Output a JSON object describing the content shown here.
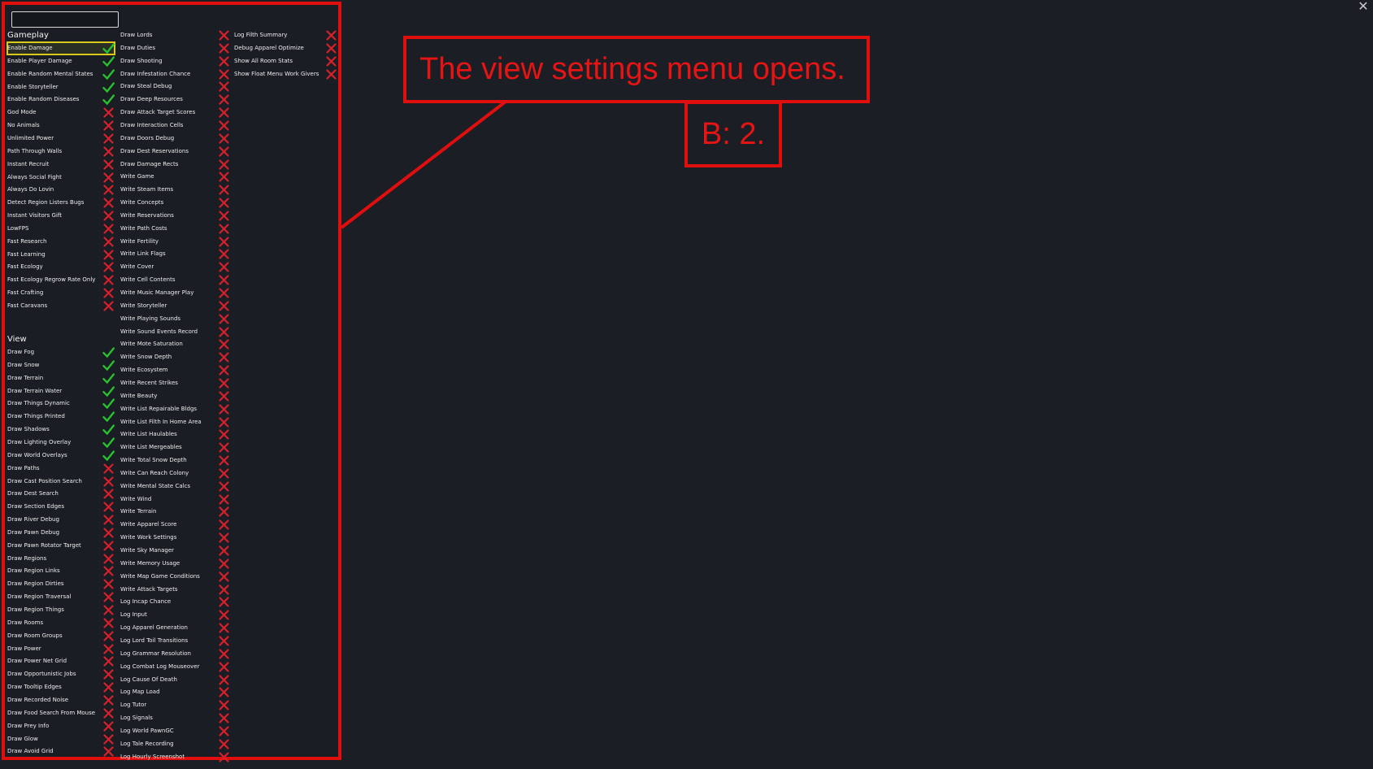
{
  "gameplay": {
    "title": "Gameplay",
    "items": [
      {
        "label": "Enable Damage",
        "on": true,
        "selected": true
      },
      {
        "label": "Enable Player Damage",
        "on": true
      },
      {
        "label": "Enable Random Mental States",
        "on": true
      },
      {
        "label": "Enable Storyteller",
        "on": true
      },
      {
        "label": "Enable Random Diseases",
        "on": true
      },
      {
        "label": "God Mode",
        "on": false
      },
      {
        "label": "No Animals",
        "on": false
      },
      {
        "label": "Unlimited Power",
        "on": false
      },
      {
        "label": "Path Through Walls",
        "on": false
      },
      {
        "label": "Instant Recruit",
        "on": false
      },
      {
        "label": "Always Social Fight",
        "on": false
      },
      {
        "label": "Always Do Lovin",
        "on": false
      },
      {
        "label": "Detect Region Listers Bugs",
        "on": false
      },
      {
        "label": "Instant Visitors Gift",
        "on": false
      },
      {
        "label": "LowFPS",
        "on": false
      },
      {
        "label": "Fast Research",
        "on": false
      },
      {
        "label": "Fast Learning",
        "on": false
      },
      {
        "label": "Fast Ecology",
        "on": false
      },
      {
        "label": "Fast Ecology Regrow Rate Only",
        "on": false
      },
      {
        "label": "Fast Crafting",
        "on": false
      },
      {
        "label": "Fast Caravans",
        "on": false
      }
    ]
  },
  "view": {
    "title": "View",
    "items": [
      {
        "label": "Draw Fog",
        "on": true
      },
      {
        "label": "Draw Snow",
        "on": true
      },
      {
        "label": "Draw Terrain",
        "on": true
      },
      {
        "label": "Draw Terrain Water",
        "on": true
      },
      {
        "label": "Draw Things Dynamic",
        "on": true
      },
      {
        "label": "Draw Things Printed",
        "on": true
      },
      {
        "label": "Draw Shadows",
        "on": true
      },
      {
        "label": "Draw Lighting Overlay",
        "on": true
      },
      {
        "label": "Draw World Overlays",
        "on": true
      },
      {
        "label": "Draw Paths",
        "on": false
      },
      {
        "label": "Draw Cast Position Search",
        "on": false
      },
      {
        "label": "Draw Dest Search",
        "on": false
      },
      {
        "label": "Draw Section Edges",
        "on": false
      },
      {
        "label": "Draw River Debug",
        "on": false
      },
      {
        "label": "Draw Pawn Debug",
        "on": false
      },
      {
        "label": "Draw Pawn Rotator Target",
        "on": false
      },
      {
        "label": "Draw Regions",
        "on": false
      },
      {
        "label": "Draw Region Links",
        "on": false
      },
      {
        "label": "Draw Region Dirties",
        "on": false
      },
      {
        "label": "Draw Region Traversal",
        "on": false
      },
      {
        "label": "Draw Region Things",
        "on": false
      },
      {
        "label": "Draw Rooms",
        "on": false
      },
      {
        "label": "Draw Room Groups",
        "on": false
      },
      {
        "label": "Draw Power",
        "on": false
      },
      {
        "label": "Draw Power Net Grid",
        "on": false
      },
      {
        "label": "Draw Opportunistic Jobs",
        "on": false
      },
      {
        "label": "Draw Tooltip Edges",
        "on": false
      },
      {
        "label": "Draw Recorded Noise",
        "on": false
      },
      {
        "label": "Draw Food Search From Mouse",
        "on": false
      },
      {
        "label": "Draw Prey Info",
        "on": false
      },
      {
        "label": "Draw Glow",
        "on": false
      },
      {
        "label": "Draw Avoid Grid",
        "on": false
      }
    ]
  },
  "column2": {
    "items": [
      {
        "label": "Draw Lords",
        "on": false
      },
      {
        "label": "Draw Duties",
        "on": false
      },
      {
        "label": "Draw Shooting",
        "on": false
      },
      {
        "label": "Draw Infestation Chance",
        "on": false
      },
      {
        "label": "Draw Steal Debug",
        "on": false
      },
      {
        "label": "Draw Deep Resources",
        "on": false
      },
      {
        "label": "Draw Attack Target Scores",
        "on": false
      },
      {
        "label": "Draw Interaction Cells",
        "on": false
      },
      {
        "label": "Draw Doors Debug",
        "on": false
      },
      {
        "label": "Draw Dest Reservations",
        "on": false
      },
      {
        "label": "Draw Damage Rects",
        "on": false
      },
      {
        "label": "Write Game",
        "on": false
      },
      {
        "label": "Write Steam Items",
        "on": false
      },
      {
        "label": "Write Concepts",
        "on": false
      },
      {
        "label": "Write Reservations",
        "on": false
      },
      {
        "label": "Write Path Costs",
        "on": false
      },
      {
        "label": "Write Fertility",
        "on": false
      },
      {
        "label": "Write Link Flags",
        "on": false
      },
      {
        "label": "Write Cover",
        "on": false
      },
      {
        "label": "Write Cell Contents",
        "on": false
      },
      {
        "label": "Write Music Manager Play",
        "on": false
      },
      {
        "label": "Write Storyteller",
        "on": false
      },
      {
        "label": "Write Playing Sounds",
        "on": false
      },
      {
        "label": "Write Sound Events Record",
        "on": false
      },
      {
        "label": "Write Mote Saturation",
        "on": false
      },
      {
        "label": "Write Snow Depth",
        "on": false
      },
      {
        "label": "Write Ecosystem",
        "on": false
      },
      {
        "label": "Write Recent Strikes",
        "on": false
      },
      {
        "label": "Write Beauty",
        "on": false
      },
      {
        "label": "Write List Repairable Bldgs",
        "on": false
      },
      {
        "label": "Write List Filth In Home Area",
        "on": false
      },
      {
        "label": "Write List Haulables",
        "on": false
      },
      {
        "label": "Write List Mergeables",
        "on": false
      },
      {
        "label": "Write Total Snow Depth",
        "on": false
      },
      {
        "label": "Write Can Reach Colony",
        "on": false
      },
      {
        "label": "Write Mental State Calcs",
        "on": false
      },
      {
        "label": "Write Wind",
        "on": false
      },
      {
        "label": "Write Terrain",
        "on": false
      },
      {
        "label": "Write Apparel Score",
        "on": false
      },
      {
        "label": "Write Work Settings",
        "on": false
      },
      {
        "label": "Write Sky Manager",
        "on": false
      },
      {
        "label": "Write Memory Usage",
        "on": false
      },
      {
        "label": "Write Map Game Conditions",
        "on": false
      },
      {
        "label": "Write Attack Targets",
        "on": false
      },
      {
        "label": "Log Incap Chance",
        "on": false
      },
      {
        "label": "Log Input",
        "on": false
      },
      {
        "label": "Log Apparel Generation",
        "on": false
      },
      {
        "label": "Log Lord Toil Transitions",
        "on": false
      },
      {
        "label": "Log Grammar Resolution",
        "on": false
      },
      {
        "label": "Log Combat Log Mouseover",
        "on": false
      },
      {
        "label": "Log Cause Of Death",
        "on": false
      },
      {
        "label": "Log Map Load",
        "on": false
      },
      {
        "label": "Log Tutor",
        "on": false
      },
      {
        "label": "Log Signals",
        "on": false
      },
      {
        "label": "Log World PawnGC",
        "on": false
      },
      {
        "label": "Log Tale Recording",
        "on": false
      },
      {
        "label": "Log Hourly Screenshot",
        "on": false
      }
    ]
  },
  "column3": {
    "items": [
      {
        "label": "Log Filth Summary",
        "on": false
      },
      {
        "label": "Debug Apparel Optimize",
        "on": false
      },
      {
        "label": "Show All Room Stats",
        "on": false
      },
      {
        "label": "Show Float Menu Work Givers",
        "on": false
      }
    ]
  },
  "annotation": {
    "caption": "The view settings menu opens.",
    "step": "B: 2."
  },
  "colors": {
    "check": "#29c22f",
    "cross": "#d8202a",
    "highlight": "#e10e0e",
    "selected_outline": "#d9c91c"
  },
  "icons": {
    "on": "checkmark-icon",
    "off": "cross-icon",
    "close": "close-icon"
  }
}
